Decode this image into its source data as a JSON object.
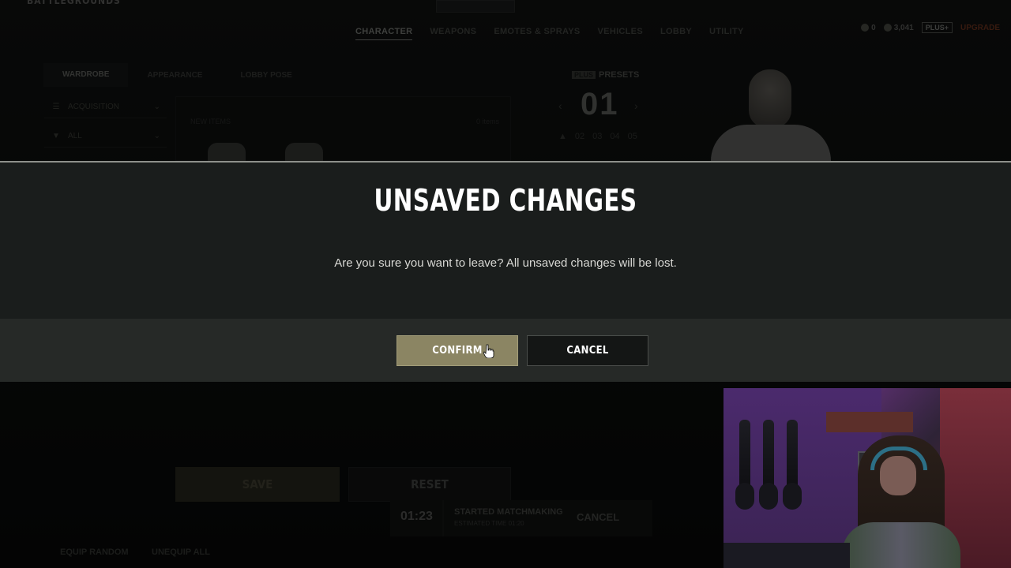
{
  "brand": "BATTLEGROUNDS",
  "main_nav": [
    "CHARACTER",
    "WEAPONS",
    "EMOTES & SPRAYS",
    "VEHICLES",
    "LOBBY",
    "UTILITY"
  ],
  "currency": {
    "coins": "0",
    "bp": "3,041",
    "plus_badge": "PLUS+",
    "upgrade": "UPGRADE"
  },
  "sub_tabs": [
    "WARDROBE",
    "APPEARANCE",
    "LOBBY POSE"
  ],
  "filters": {
    "sort_label": "ACQUISITION",
    "filter_label": "ALL"
  },
  "items": {
    "new_label": "NEW ITEMS",
    "count": "0 items"
  },
  "presets": {
    "badge": "PLUS",
    "title": "PRESETS",
    "current": "01",
    "list": [
      "02",
      "03",
      "04",
      "05"
    ]
  },
  "bottom": {
    "save": "SAVE",
    "reset": "RESET",
    "equip_random": "EQUIP RANDOM",
    "unequip_all": "UNEQUIP ALL"
  },
  "matchmaking": {
    "timer": "01:23",
    "title": "STARTED MATCHMAKING",
    "estimate": "ESTIMATED TIME 01:20",
    "cancel": "CANCEL"
  },
  "modal": {
    "title": "UNSAVED CHANGES",
    "message": "Are you sure you want to leave? All unsaved changes will be lost.",
    "confirm": "CONFIRM",
    "cancel": "CANCEL"
  },
  "colors": {
    "confirm_bg": "#8b8563",
    "modal_bg": "#1a1d1c",
    "modal_footer_bg": "#262927"
  }
}
